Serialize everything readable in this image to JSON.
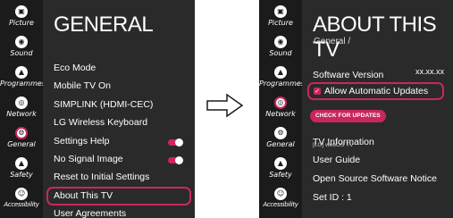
{
  "left": {
    "title": "GENERAL",
    "sidebar": [
      {
        "label": "Picture",
        "glyph": "▣",
        "active": false
      },
      {
        "label": "Sound",
        "glyph": "◉",
        "active": false
      },
      {
        "label": "Programmes",
        "glyph": "▲",
        "active": false
      },
      {
        "label": "Network",
        "glyph": "◎",
        "active": false
      },
      {
        "label": "General",
        "glyph": "⚙",
        "active": true
      },
      {
        "label": "Safety",
        "glyph": "▲",
        "active": false
      },
      {
        "label": "Accessibility",
        "glyph": "☺",
        "active": false
      }
    ],
    "menu": [
      {
        "label": "Eco Mode"
      },
      {
        "label": "Mobile TV On"
      },
      {
        "label": "SIMPLINK (HDMI-CEC)"
      },
      {
        "label": "LG Wireless Keyboard"
      },
      {
        "label": "Settings Help",
        "toggle": true
      },
      {
        "label": "No Signal Image",
        "toggle": true
      },
      {
        "label": "Reset to Initial Settings"
      },
      {
        "label": "About This TV",
        "selected": true
      },
      {
        "label": "User Agreements"
      }
    ]
  },
  "right": {
    "title": "ABOUT THIS TV",
    "breadcrumb": "General /",
    "sidebar": [
      {
        "label": "Picture",
        "glyph": "▣",
        "active": false
      },
      {
        "label": "Sound",
        "glyph": "◉",
        "active": false
      },
      {
        "label": "Programmes",
        "glyph": "▲",
        "active": false
      },
      {
        "label": "Network",
        "glyph": "◎",
        "active": true
      },
      {
        "label": "General",
        "glyph": "⚙",
        "active": false
      },
      {
        "label": "Safety",
        "glyph": "▲",
        "active": false
      },
      {
        "label": "Accessibility",
        "glyph": "☺",
        "active": false
      }
    ],
    "software_version_label": "Software Version",
    "software_version_value": "xx.xx.xx",
    "auto_updates_label": "Allow Automatic Updates",
    "check_button": "CHECK FOR UPDATES",
    "tv_information": "TV Information",
    "webos_tv": "[LG] webOS TV",
    "user_guide": "User Guide",
    "open_source": "Open Source Software Notice",
    "set_id": "Set ID : 1"
  },
  "colors": {
    "accent": "#c9275c",
    "panel": "#1b1b1b",
    "content": "#2a2a2a"
  }
}
